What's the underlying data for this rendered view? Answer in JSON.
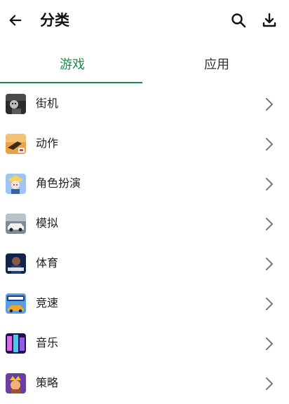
{
  "header": {
    "title": "分类",
    "back_icon": "arrow-left-icon",
    "search_icon": "search-icon",
    "download_icon": "download-icon"
  },
  "tabs": [
    {
      "label": "游戏",
      "active": true
    },
    {
      "label": "应用",
      "active": false
    }
  ],
  "colors": {
    "accent": "#1f8a4c"
  },
  "categories": [
    {
      "label": "街机",
      "thumb_icon": "arcade-thumbnail-icon"
    },
    {
      "label": "动作",
      "thumb_icon": "action-thumbnail-icon"
    },
    {
      "label": "角色扮演",
      "thumb_icon": "rpg-thumbnail-icon"
    },
    {
      "label": "模拟",
      "thumb_icon": "simulation-thumbnail-icon"
    },
    {
      "label": "体育",
      "thumb_icon": "sports-thumbnail-icon"
    },
    {
      "label": "竞速",
      "thumb_icon": "racing-thumbnail-icon"
    },
    {
      "label": "音乐",
      "thumb_icon": "music-thumbnail-icon"
    },
    {
      "label": "策略",
      "thumb_icon": "strategy-thumbnail-icon"
    }
  ]
}
